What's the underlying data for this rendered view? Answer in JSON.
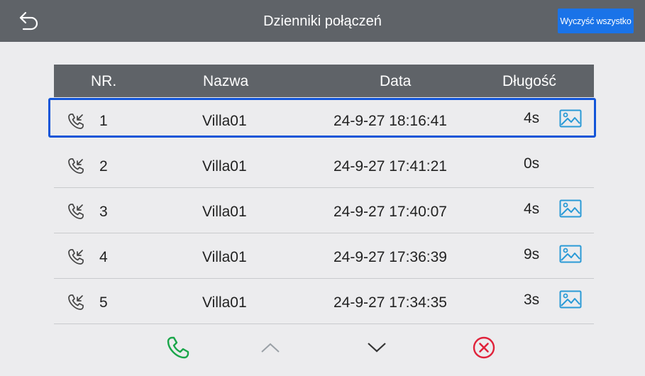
{
  "header": {
    "title": "Dzienniki połączeń",
    "clear_all_label": "Wyczyść wszystko",
    "accent_color": "#1a73e8",
    "bar_color": "#5f6368"
  },
  "table": {
    "columns": [
      "NR.",
      "Nazwa",
      "Data",
      "Długość"
    ],
    "selected_row": 1,
    "rows": [
      {
        "nr": "1",
        "name": "Villa01",
        "date": "24-9-27 18:16:41",
        "duration": "4s",
        "has_snapshot": true,
        "call_icon": "incoming-call-icon"
      },
      {
        "nr": "2",
        "name": "Villa01",
        "date": "24-9-27 17:41:21",
        "duration": "0s",
        "has_snapshot": false,
        "call_icon": "incoming-call-icon"
      },
      {
        "nr": "3",
        "name": "Villa01",
        "date": "24-9-27 17:40:07",
        "duration": "4s",
        "has_snapshot": true,
        "call_icon": "incoming-call-icon"
      },
      {
        "nr": "4",
        "name": "Villa01",
        "date": "24-9-27 17:36:39",
        "duration": "9s",
        "has_snapshot": true,
        "call_icon": "incoming-call-icon"
      },
      {
        "nr": "5",
        "name": "Villa01",
        "date": "24-9-27 17:34:35",
        "duration": "3s",
        "has_snapshot": true,
        "call_icon": "incoming-call-icon"
      }
    ]
  },
  "footer": {
    "icons": [
      "phone-call-icon",
      "chevron-up-icon",
      "chevron-down-icon",
      "delete-circle-icon"
    ],
    "call_color": "#1aa64a",
    "delete_color": "#e0223a"
  }
}
